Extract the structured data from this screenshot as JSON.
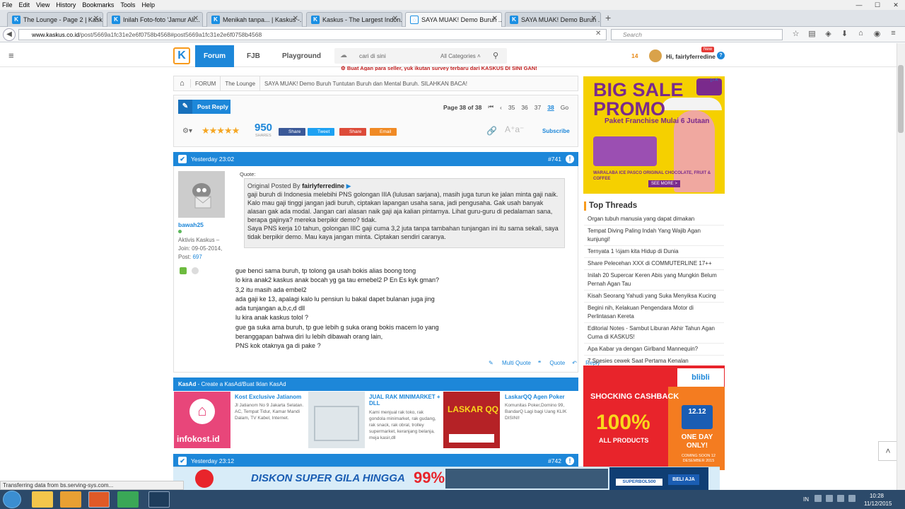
{
  "menubar": {
    "items": [
      "File",
      "Edit",
      "View",
      "History",
      "Bookmarks",
      "Tools",
      "Help"
    ]
  },
  "tabs": [
    {
      "label": "The Lounge - Page 2 | Kask...",
      "active": false
    },
    {
      "label": "Inilah Foto-foto 'Jamur Ali...",
      "active": false
    },
    {
      "label": "Menikah tanpa... | Kaskus -...",
      "active": false
    },
    {
      "label": "Kaskus - The Largest Indon...",
      "active": false
    },
    {
      "label": "SAYA MUAK! Demo Buruh ...",
      "active": true
    },
    {
      "label": "SAYA MUAK! Demo Buruh ...",
      "active": false
    }
  ],
  "nav": {
    "url_domain": "www.kaskus.co.id",
    "url_path": "/post/5669a1fc31e2e6f0758b4568#post5669a1fc31e2e6f0758b4568",
    "search_placeholder": "Search"
  },
  "header": {
    "logo": "K",
    "nav_items": [
      "Forum",
      "FJB",
      "Playground"
    ],
    "search_placeholder": "cari di sini",
    "category": "All Categories",
    "notif_count": "14",
    "greeting": "Hi, fairlyferredine",
    "new_badge": "New",
    "help": "?"
  },
  "announcement": "Buat Agan para seller, yuk ikutan survey terbaru dari KASKUS DI SINI GAN!",
  "breadcrumb": [
    "FORUM",
    "The Lounge",
    "SAYA MUAK! Demo Buruh Tuntutan Buruh dan Mental Buruh. SILAHKAN BACA!"
  ],
  "toolbox": {
    "post_reply": "Post Reply",
    "page_label": "Page 38 of 38",
    "pages": [
      "35",
      "36",
      "37",
      "38"
    ],
    "current_page": "38",
    "go": "Go",
    "share_count": "950",
    "shares_label": "SHARES",
    "share_buttons": [
      {
        "label": "Share",
        "color": "#3b5998"
      },
      {
        "label": "Tweet",
        "color": "#1da1f2"
      },
      {
        "label": "Share",
        "color": "#dd4b39"
      },
      {
        "label": "Email",
        "color": "#f08a24"
      }
    ],
    "subscribe": "Subscribe",
    "rating_stars": 5
  },
  "post": {
    "time": "Yesterday 23:02",
    "number": "#741",
    "username": "bawah25",
    "user_info": "Aktivis Kaskus – Join: 09-05-2014, Post:",
    "post_count": "697",
    "quote_label": "Quote:",
    "quote_by_prefix": "Original Posted By",
    "quote_author": "fairlyferredine",
    "quote_text": "gaji buruh di Indonesia melebihi PNS golongan IIIA (lulusan sarjana), masih juga turun ke jalan minta gaji naik. Kalo mau gaji tinggi jangan jadi buruh, ciptakan lapangan usaha sana, jadi pengusaha. Gak usah banyak alasan gak ada modal. Jangan cari alasan naik gaji aja kalian pintarnya. Lihat guru-guru di pedalaman sana, berapa gajinya? mereka berpikir demo? tidak.",
    "quote_text2": "Saya PNS kerja 10 tahun, golongan IIIC gaji cuma 3,2 juta tanpa tambahan tunjangan ini itu sama sekali, saya tidak berpikir demo. Mau kaya jangan minta. Ciptakan sendiri caranya.",
    "body_lines": [
      "gue benci sama buruh, tp tolong ga usah bokis alias boong tong",
      "lo kira anak2 kaskus anak bocah yg ga tau emebel2 P En Es kyk gman?",
      "3,2 itu masih ada embel2",
      "ada gaji ke 13, apalagi kalo lu pensiun lu bakal dapet bulanan juga jing",
      "ada tunjangan a,b,c,d dll",
      "lu kira anak kaskus tolol ?",
      "gue ga suka ama buruh, tp gue lebih g suka orang bokis macem lo yang",
      "beranggapan bahwa diri lu lebih dibawah orang lain,",
      "PNS kok otaknya ga di pake ?"
    ],
    "actions": [
      "Multi Quote",
      "Quote",
      "Reply"
    ]
  },
  "kasad": {
    "title": "KasAd",
    "subtitle": " - Create a KasAd/Buat Iklan KasAd",
    "ads": [
      {
        "title": "Kost Exclusive Jatianom",
        "desc": "Jl Jatianom No 9 Jakarta Selatan. AC, Tempat Tidur, Kamar Mandi Dalam, TV Kabel, Internet.",
        "img_text": "infokost.id",
        "img_color": "#e8467a"
      },
      {
        "title": "JUAL RAK MINIMARKET + DLL",
        "desc": "Kami menjual rak toko, rak gondola minimarket, rak gudang, rak snack, rak obral, trolley supermarket, keranjang belanja, meja kasir,dll",
        "img_text": "",
        "img_color": "#dfe6ea"
      },
      {
        "title": "LaskarQQ Agen Poker",
        "desc": "Komunitas Poker,Domino 99, BandarQ Lagi bagi Uang KLIK DISINI!",
        "img_text": "LASKAR QQ",
        "img_color": "#b52226"
      }
    ]
  },
  "next_post": {
    "time": "Yesterday 23:12",
    "number": "#742"
  },
  "sidebar": {
    "bigsale_title": "BIG SALE PROMO",
    "bigsale_sub": "Paket Franchise Mulai 6 Jutaan",
    "bigsale_desc": "WARALABA ICE PASCO ORIGINAL CHOCOLATE, FRUIT & COFFEE",
    "bigsale_more": "SEE MORE >",
    "top_threads_title": "Top Threads",
    "threads": [
      "Organ tubuh manusia yang dapat dimakan",
      "Tempat Diving Paling Indah Yang Wajib Agan kunjungi!",
      "Ternyata 1 ½jam kita Hidup di Dunia",
      "Share Pelecehan XXX di COMMUTERLINE 17++",
      "Inilah 20 Supercar Keren Abis yang Mungkin Belum Pernah Agan Tau",
      "Kisah Seorang Yahudi yang Suka Menyiksa Kucing",
      "Begini nih, Kelakuan Pengendara Motor di Perlintasan Kereta",
      "Editorial Notes - Sambut Liburan Akhir Tahun Agan Cuma di KASKUS!",
      "Apa Kabar ya dengan Girlband Mannequin?",
      "7 Spesies cewek Saat Pertama Kenalan"
    ],
    "blibli_logo": "blibli",
    "blibli_shock": "SHOCKING CASHBACK",
    "blibli_pct": "100%",
    "blibli_all": "ALL PRODUCTS",
    "blibli_cal": "12.12",
    "blibli_oneday": "ONE DAY ONLY!",
    "blibli_soon": "COMING SOON 12 DESEMBER 2015"
  },
  "bottom_banner": {
    "text": "DISKON SUPER GILA HINGGA",
    "pct": "99%",
    "code": "SUPERBOL500",
    "buy": "BELI AJA"
  },
  "status": "Transferring data from bs.serving-sys.com...",
  "taskbar": {
    "lang": "IN",
    "time": "10:28",
    "date": "11/12/2015"
  }
}
